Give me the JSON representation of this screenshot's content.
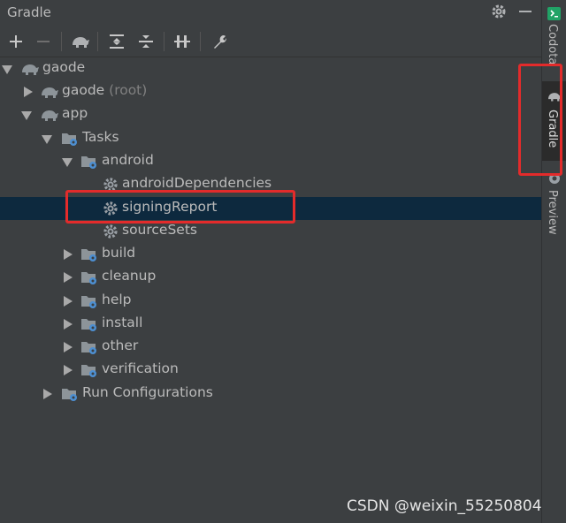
{
  "panel": {
    "title": "Gradle"
  },
  "toolbar": {
    "buttons": [
      "add-icon",
      "remove-icon",
      "gradle-elephant-icon",
      "expand-all-icon",
      "collapse-all-icon",
      "toggle-offline-icon",
      "wrench-icon"
    ]
  },
  "tree": {
    "root": {
      "label": "gaode"
    },
    "gaode_root": {
      "label": "gaode",
      "suffix": "(root)"
    },
    "app": {
      "label": "app"
    },
    "tasks": {
      "label": "Tasks"
    },
    "android": {
      "label": "android"
    },
    "task_items": [
      {
        "label": "androidDependencies"
      },
      {
        "label": "signingReport"
      },
      {
        "label": "sourceSets"
      }
    ],
    "task_groups": [
      {
        "label": "build"
      },
      {
        "label": "cleanup"
      },
      {
        "label": "help"
      },
      {
        "label": "install"
      },
      {
        "label": "other"
      },
      {
        "label": "verification"
      }
    ],
    "run_configurations": {
      "label": "Run Configurations"
    }
  },
  "rightbar": {
    "tabs": [
      {
        "label": "Codota"
      },
      {
        "label": "Gradle"
      },
      {
        "label": "Preview"
      }
    ]
  },
  "watermark": "CSDN @weixin_55250804",
  "colors": {
    "background": "#3c3f41",
    "selection": "#0d293e",
    "highlight": "#e32b2b",
    "gear": "#6b9bd1"
  }
}
